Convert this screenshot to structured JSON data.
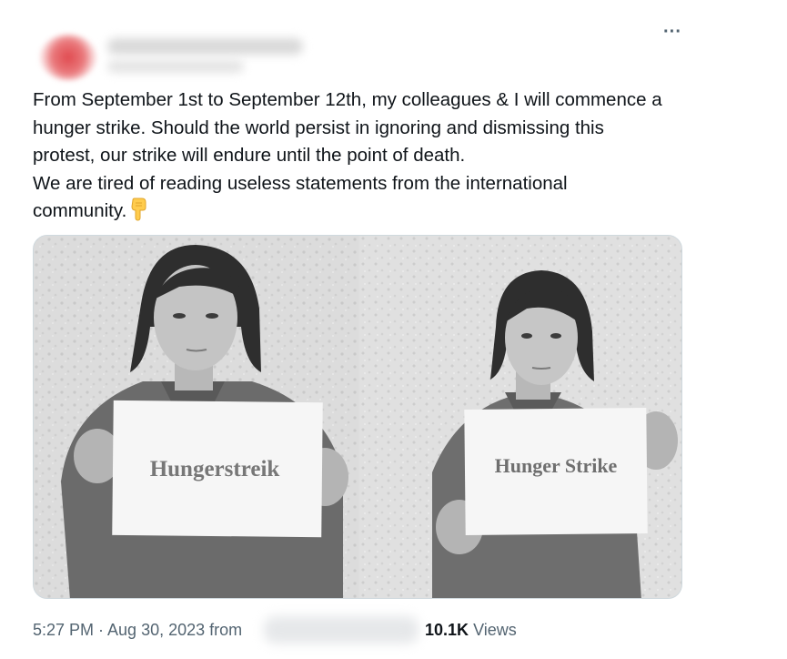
{
  "header": {
    "more_icon": "more-horizontal-icon",
    "more_label": "···"
  },
  "tweet": {
    "lines": [
      "From September 1st to September 12th, my colleagues & I will commence a",
      "hunger strike. Should the world persist in ignoring and dismissing this",
      "protest, our strike will endure until the point of death.",
      "We are tired of reading useless statements from the international",
      "community."
    ],
    "emoji": "point-down-emoji"
  },
  "media": {
    "photos": [
      {
        "sign_text": "Hungerstreik"
      },
      {
        "sign_text": "Hunger Strike"
      }
    ]
  },
  "footer": {
    "timestamp": "5:27 PM · Aug 30, 2023 from",
    "views_count": "10.1K",
    "views_label": "Views"
  }
}
